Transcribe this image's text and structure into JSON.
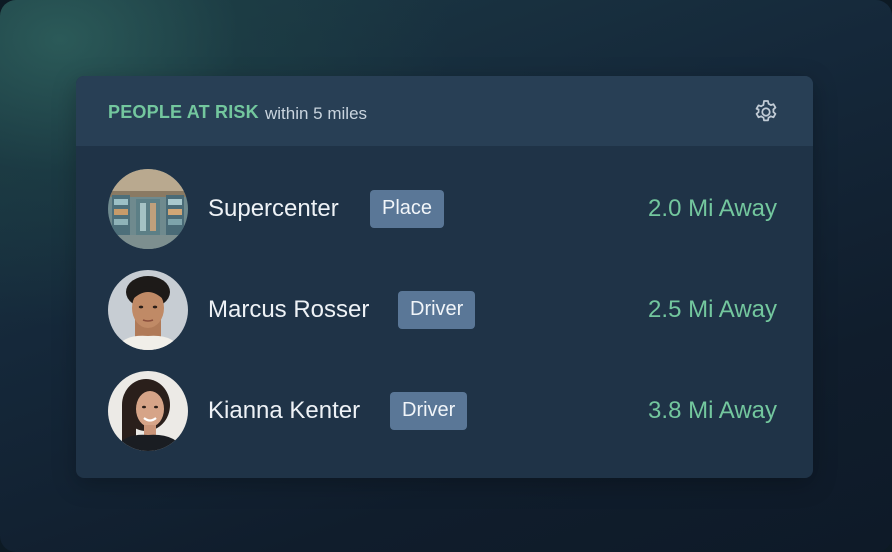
{
  "panel": {
    "title": "PEOPLE AT RISK",
    "subtitle": "within 5 miles",
    "settings_icon": "gear-icon"
  },
  "colors": {
    "accent": "#73c79e",
    "badge": "#5a7797",
    "card": "#1f3347",
    "header": "#283f55"
  },
  "rows": [
    {
      "name": "Supercenter",
      "type": "Place",
      "distance": "2.0 Mi Away",
      "avatar": "store-photo"
    },
    {
      "name": "Marcus Rosser",
      "type": "Driver",
      "distance": "2.5 Mi Away",
      "avatar": "person-photo"
    },
    {
      "name": "Kianna Kenter",
      "type": "Driver",
      "distance": "3.8 Mi Away",
      "avatar": "person-photo"
    }
  ]
}
